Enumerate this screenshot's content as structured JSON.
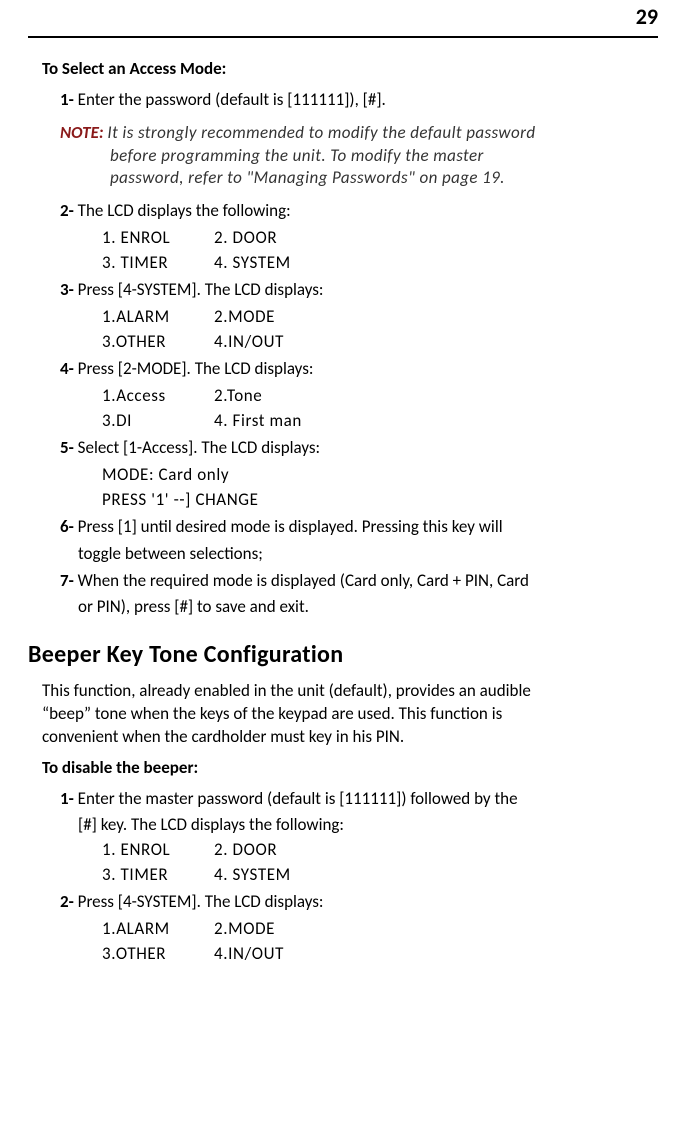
{
  "page_number": "29",
  "sect1": {
    "title": "To Select an Access Mode:",
    "step1": {
      "num": "1-",
      "text": "Enter the password (default is [111111]), [#]."
    },
    "note": {
      "label": "NOTE:",
      "line1": "It is strongly recommended to modify the default password",
      "line2": "before programming the unit. To modify the master",
      "line3": "password, refer to \"Managing Passwords\" on page 19."
    },
    "step2": {
      "num": "2-",
      "text": "The LCD displays the following:",
      "lcd": [
        [
          "1. ENROL",
          "2. DOOR"
        ],
        [
          "3. TIMER",
          "4. SYSTEM"
        ]
      ]
    },
    "step3": {
      "num": "3-",
      "text": "Press [4-SYSTEM]. The LCD displays:",
      "lcd": [
        [
          "1.ALARM",
          "2.MODE"
        ],
        [
          "3.OTHER",
          "4.IN/OUT"
        ]
      ]
    },
    "step4": {
      "num": "4-",
      "text": "Press [2-MODE]. The LCD displays:",
      "lcd": [
        [
          "1.Access",
          "2.Tone"
        ],
        [
          "3.DI",
          "4. First man"
        ]
      ]
    },
    "step5": {
      "num": "5-",
      "text": "Select [1-Access]. The LCD displays:",
      "lcd": [
        [
          "MODE: Card only",
          ""
        ],
        [
          "PRESS '1' --] CHANGE",
          ""
        ]
      ]
    },
    "step6": {
      "num": "6-",
      "text": "Press [1] until desired mode is displayed. Pressing this key will",
      "cont": "toggle between selections;"
    },
    "step7": {
      "num": "7-",
      "text": "When the required mode is displayed (Card only, Card + PIN, Card",
      "cont": "or PIN), press [#] to save and exit."
    }
  },
  "sect2": {
    "heading": "Beeper Key Tone Configuration",
    "intro1": "This function, already enabled in the unit (default), provides an audible",
    "intro2": "“beep” tone when the keys of the keypad are used. This function is",
    "intro3": "convenient when the cardholder must key in his PIN.",
    "subtitle": "To disable the beeper:",
    "step1": {
      "num": "1-",
      "text": "Enter the master password (default is [111111]) followed by the",
      "cont": "[#] key. The LCD displays the following:",
      "lcd": [
        [
          "1. ENROL",
          "2. DOOR"
        ],
        [
          "3. TIMER",
          "4. SYSTEM"
        ]
      ]
    },
    "step2": {
      "num": "2-",
      "text": "Press [4-SYSTEM]. The LCD displays:",
      "lcd": [
        [
          "1.ALARM",
          "2.MODE"
        ],
        [
          "3.OTHER",
          "4.IN/OUT"
        ]
      ]
    }
  }
}
